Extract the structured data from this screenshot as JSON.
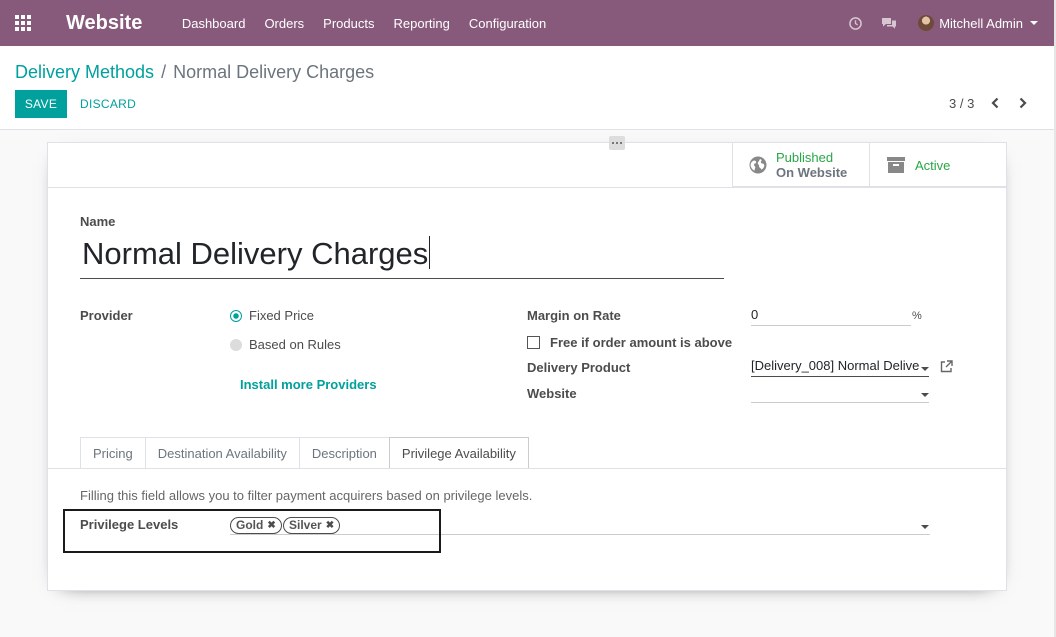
{
  "navbar": {
    "brand": "Website",
    "menu": [
      "Dashboard",
      "Orders",
      "Products",
      "Reporting",
      "Configuration"
    ],
    "user_name": "Mitchell Admin",
    "icons": [
      "apps-grid-icon",
      "clock-icon",
      "chat-icon"
    ],
    "color": "#875a7b"
  },
  "breadcrumb": {
    "parent": "Delivery Methods",
    "separator": "/",
    "current": "Normal Delivery Charges"
  },
  "actions": {
    "save": "SAVE",
    "discard": "DISCARD"
  },
  "pager": {
    "text": "3 / 3"
  },
  "stat_buttons": {
    "published_title": "Published",
    "published_sub": "On Website",
    "active": "Active"
  },
  "form": {
    "name_label": "Name",
    "name_value": "Normal Delivery Charges",
    "provider_label": "Provider",
    "provider_options": [
      "Fixed Price",
      "Based on Rules"
    ],
    "provider_selected": "Fixed Price",
    "install_more": "Install more Providers",
    "margin_label": "Margin on Rate",
    "margin_value": "0",
    "margin_unit": "%",
    "free_label": "Free if order amount is above",
    "delivery_product_label": "Delivery Product",
    "delivery_product_value": "[Delivery_008] Normal Delive",
    "website_label": "Website",
    "website_value": ""
  },
  "tabs": [
    "Pricing",
    "Destination Availability",
    "Description",
    "Privilege Availability"
  ],
  "active_tab": "Privilege Availability",
  "privilege": {
    "help": "Filling this field allows you to filter payment acquirers based on privilege levels.",
    "label": "Privilege Levels",
    "tags": [
      "Gold",
      "Silver"
    ]
  },
  "colors": {
    "accent": "#00a09d",
    "success": "#28a745"
  }
}
